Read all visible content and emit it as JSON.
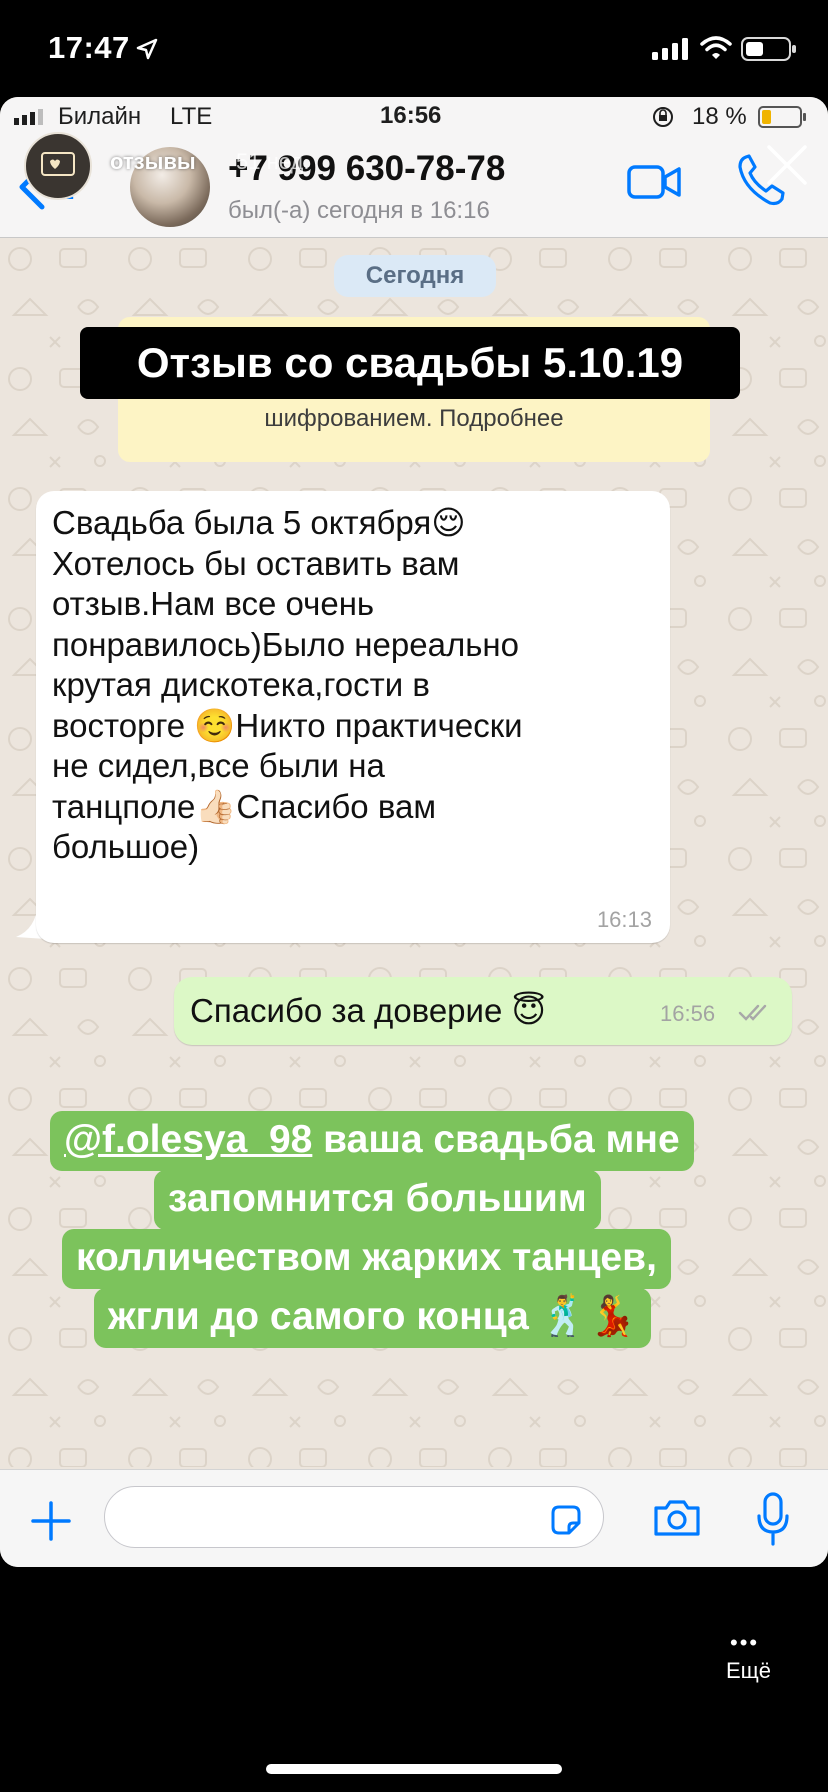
{
  "os_status": {
    "time": "17:47"
  },
  "inner_status": {
    "carrier": "Билайн",
    "network": "LTE",
    "time": "16:56",
    "battery": "18 %"
  },
  "story": {
    "account": "отзывы",
    "age": "51 нед."
  },
  "chat": {
    "back_count": "2",
    "contact_name": "+7 999 630-78-78",
    "contact_status": "был(-а) сегодня в 16:16",
    "date_label": "Сегодня",
    "system_text": "шифрованием. Подробнее",
    "title_overlay": "Отзыв со свадьбы 5.10.19",
    "incoming": {
      "text": "Свадьба была 5 октября😌\nХотелось бы оставить вам\nотзыв.Нам  все очень\nпонравилось)Было нереально\nкрутая дискотека,гости в\nвосторге ☺️Никто практически\nне сидел,все были на\nтанцполе👍🏻Спасибо вам\nбольшое)",
      "time": "16:13"
    },
    "outgoing": {
      "text": "Спасибо за доверие 😇",
      "time": "16:56"
    }
  },
  "caption": {
    "handle": "@f.olesya_98",
    "line1_rest": " ваша свадьба мне",
    "line2": "запомнится большим",
    "line3": "колличеством жарких танцев,",
    "line4": "жгли до самого конца 🕺💃"
  },
  "more": {
    "dots": "•••",
    "label": "Ещё"
  },
  "colors": {
    "chat_bg": "#ece5dd",
    "incoming_bubble": "#ffffff",
    "outgoing_bubble": "#dcf8c6",
    "caption_green": "#7cc35c",
    "ios_blue": "#007aff",
    "system_bubble": "#fdf4c5"
  }
}
